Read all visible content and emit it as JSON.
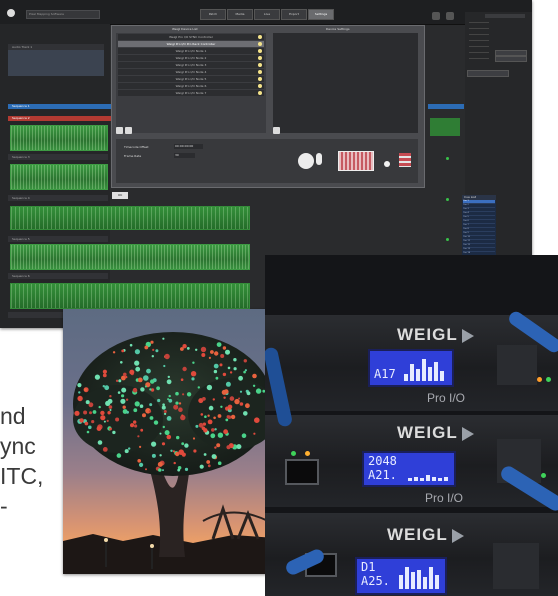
{
  "toolbar": {
    "window_title": "Pixel Mapping Software",
    "buttons": [
      "Patch",
      "Media",
      "Live",
      "Export",
      "Settings"
    ],
    "active_index": 4
  },
  "dialog": {
    "devices_header": "Weigl Device List",
    "detail_header": "Device Settings",
    "devices": [
      "Weigl Pro I/O SYNC Controller",
      "Weigl Pro I/O Pro Rack Controller",
      "Weigl Pro I/O Node 1",
      "Weigl Pro I/O Node 2",
      "Weigl Pro I/O Node 3",
      "Weigl Pro I/O Node 4",
      "Weigl Pro I/O Node 5",
      "Weigl Pro I/O Node 6",
      "Weigl Pro I/O Node 7"
    ],
    "selected_device": 1,
    "fields": [
      {
        "label": "Timecode Offset",
        "value": "00:00:00:00"
      },
      {
        "label": "Frame Rate",
        "value": "30"
      }
    ],
    "ok_label": "OK"
  },
  "tracks": [
    "Audio Track 1",
    "Sequence 1",
    "Sequence 2",
    "Sequence 3",
    "Sequence 4",
    "Sequence 5",
    "Sequence 6"
  ],
  "banks": {
    "header": "Cue List",
    "items": [
      "Cue 1",
      "Cue 2",
      "Cue 3",
      "Cue 4",
      "Cue 5",
      "Cue 6",
      "Cue 7",
      "Cue 8",
      "Cue 9",
      "Cue 10",
      "Cue 11",
      "Cue 12",
      "Cue 13",
      "Cue 14",
      "Cue 15",
      "Cue 16",
      "Cue 17",
      "Cue 18",
      "Cue 19",
      "Cue 20",
      "Cue 21",
      "Cue 22",
      "Cue 23",
      "Cue 24"
    ],
    "selected": 0
  },
  "side_text": [
    "nd",
    "ync",
    "ITC,",
    "-"
  ],
  "hardware": {
    "brand": "WEIGL",
    "model": "Pro I/O",
    "units": [
      {
        "line1": "",
        "line2": "A17"
      },
      {
        "line1": "2048",
        "line2": "A21."
      },
      {
        "line1": "D1",
        "line2": "A25."
      }
    ]
  },
  "colors": {
    "wave_green": "#2f7d34",
    "lcd_blue": "#2f3fd8",
    "selection_blue": "#2c6cb5",
    "sunset": "#f0a265"
  }
}
